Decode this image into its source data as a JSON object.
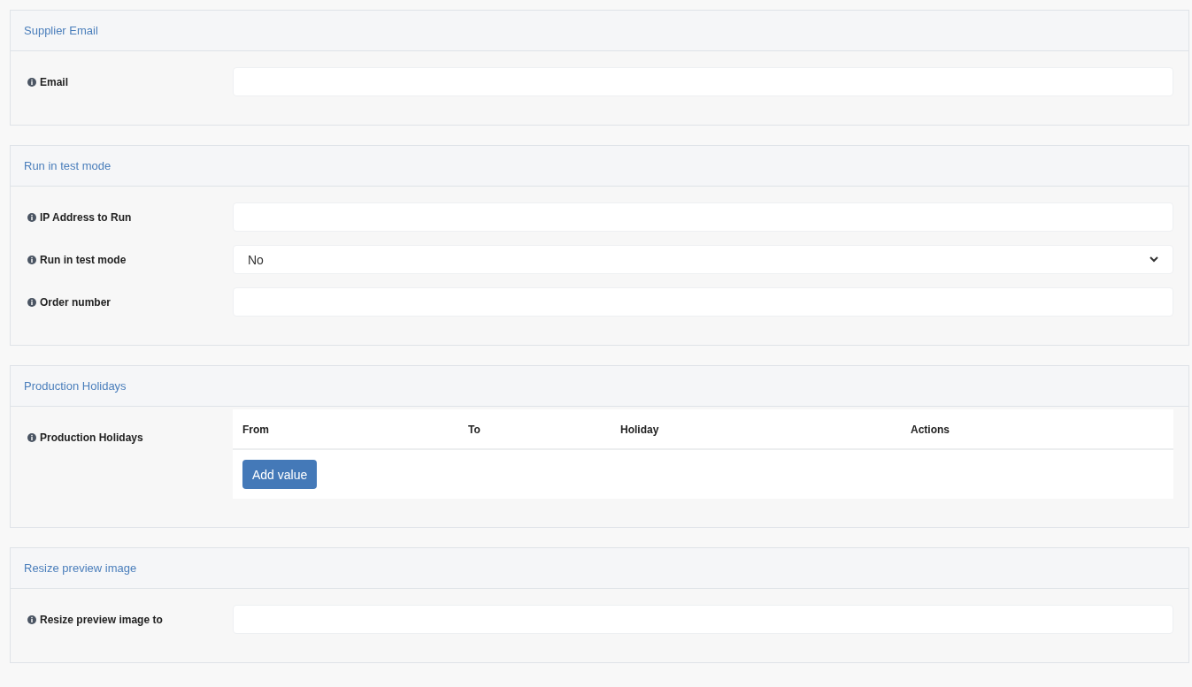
{
  "sections": [
    {
      "title": "Supplier Email",
      "fields": [
        {
          "kind": "input",
          "label": "Email"
        }
      ]
    },
    {
      "title": "Run in test mode",
      "fields": [
        {
          "kind": "input",
          "label": "IP Address to Run"
        },
        {
          "kind": "select",
          "label": "Run in test mode",
          "value": "No"
        },
        {
          "kind": "input",
          "label": "Order number"
        }
      ]
    },
    {
      "title": "Production Holidays",
      "fields": [
        {
          "kind": "table",
          "label": "Production Holidays",
          "columns": [
            "From",
            "To",
            "Holiday",
            "Actions"
          ],
          "button": "Add value"
        }
      ]
    },
    {
      "title": "Resize preview image",
      "fields": [
        {
          "kind": "input",
          "label": "Resize preview image to"
        }
      ]
    }
  ]
}
